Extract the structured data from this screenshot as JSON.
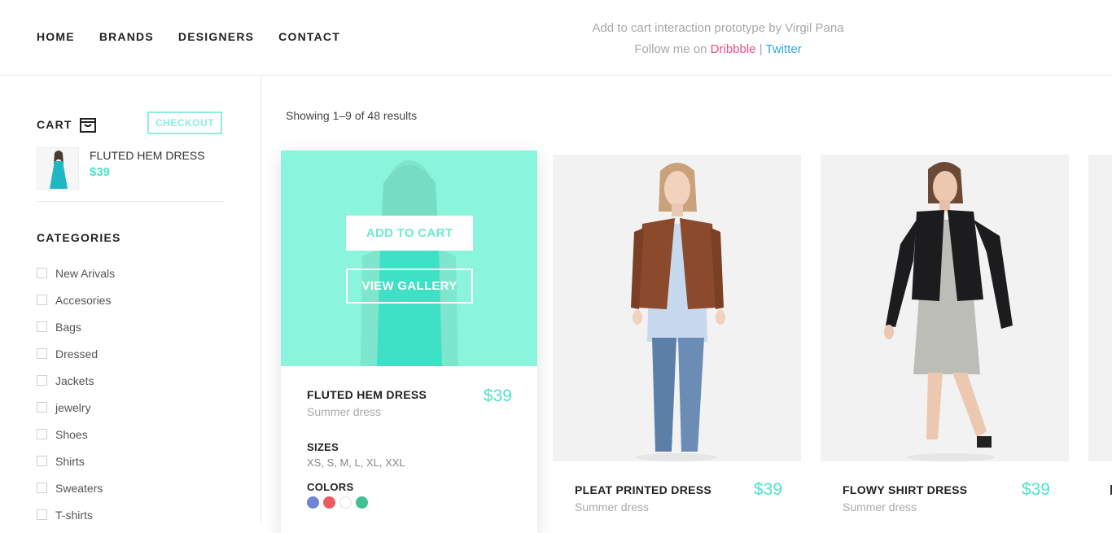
{
  "nav": {
    "items": [
      "HOME",
      "BRANDS",
      "DESIGNERS",
      "CONTACT"
    ]
  },
  "credit": {
    "line1": "Add to cart interaction prototype by Virgil Pana",
    "follow": "Follow me on",
    "dribbble": "Dribbble",
    "separator": "|",
    "twitter": "Twitter"
  },
  "cart": {
    "title": "CART",
    "checkout_label": "CHECKOUT",
    "item": {
      "name": "FLUTED HEM DRESS",
      "price": "$39"
    }
  },
  "categories": {
    "title": "CATEGORIES",
    "items": [
      "New Arivals",
      "Accesories",
      "Bags",
      "Dressed",
      "Jackets",
      "jewelry",
      "Shoes",
      "Shirts",
      "Sweaters",
      "T-shirts"
    ]
  },
  "results_text": "Showing 1–9 of 48 results",
  "products": [
    {
      "name": "FLUTED HEM DRESS",
      "subtitle": "Summer dress",
      "price": "$39",
      "add_to_cart": "ADD TO CART",
      "view_gallery": "VIEW GALLERY",
      "sizes_label": "SIZES",
      "sizes": "XS, S, M, L, XL, XXL",
      "colors_label": "COLORS",
      "colors": [
        "#6e85d6",
        "#ee5a63",
        "#ffffff",
        "#3fc08f"
      ]
    },
    {
      "name": "PLEAT PRINTED DRESS",
      "subtitle": "Summer dress",
      "price": "$39"
    },
    {
      "name": "FLOWY SHIRT DRESS",
      "subtitle": "Summer dress",
      "price": "$39"
    }
  ],
  "accent_color": "#4fe3c8"
}
